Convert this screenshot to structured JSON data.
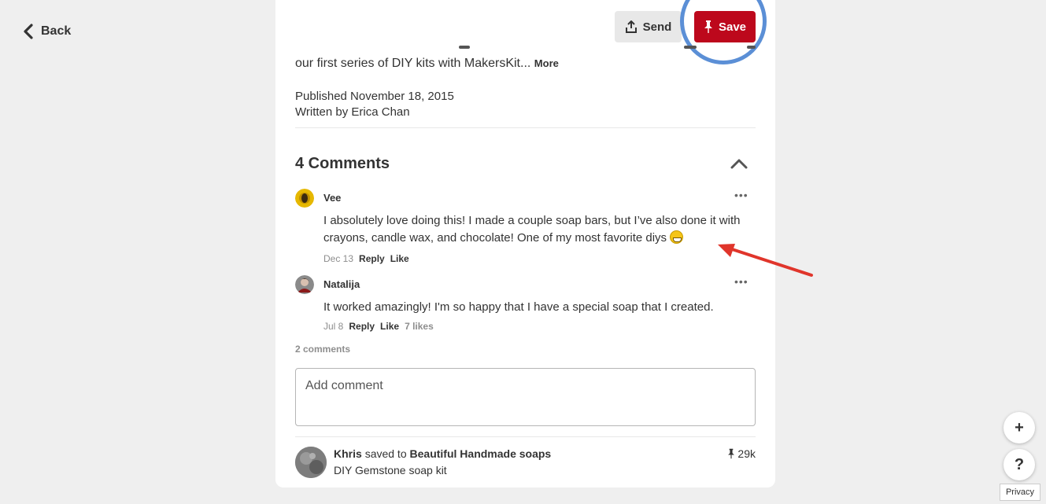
{
  "nav": {
    "back_label": "Back"
  },
  "actions": {
    "send_label": "Send",
    "save_label": "Save"
  },
  "pin": {
    "description_visible": "our first series of DIY kits with MakersKit...",
    "more_label": "More",
    "published": "Published November 18, 2015",
    "author": "Written by Erica Chan"
  },
  "comments": {
    "title": "4 Comments",
    "items": [
      {
        "name": "Vee",
        "text": "I absolutely love doing this! I made a couple soap bars, but I’ve also done it with crayons, candle wax, and chocolate! One of my most favorite diys",
        "date": "Dec 13",
        "reply": "Reply",
        "like": "Like",
        "likes": ""
      },
      {
        "name": "Natalija",
        "text": "It worked amazingly! I'm so happy that I have a special soap that I created.",
        "date": "Jul 8",
        "reply": "Reply",
        "like": "Like",
        "likes": "7 likes"
      }
    ],
    "count_label": "2 comments",
    "add_placeholder": "Add comment"
  },
  "saved_by": {
    "user": "Khris",
    "action": "saved to",
    "board": "Beautiful Handmade soaps",
    "pin_title": "DIY Gemstone soap kit",
    "pin_count": "29k"
  },
  "floating": {
    "plus": "+",
    "help": "?",
    "privacy": "Privacy"
  },
  "colors": {
    "save_red": "#bd081c",
    "highlight_ring": "#5b8fd6",
    "annotation_arrow": "#e0352b"
  }
}
